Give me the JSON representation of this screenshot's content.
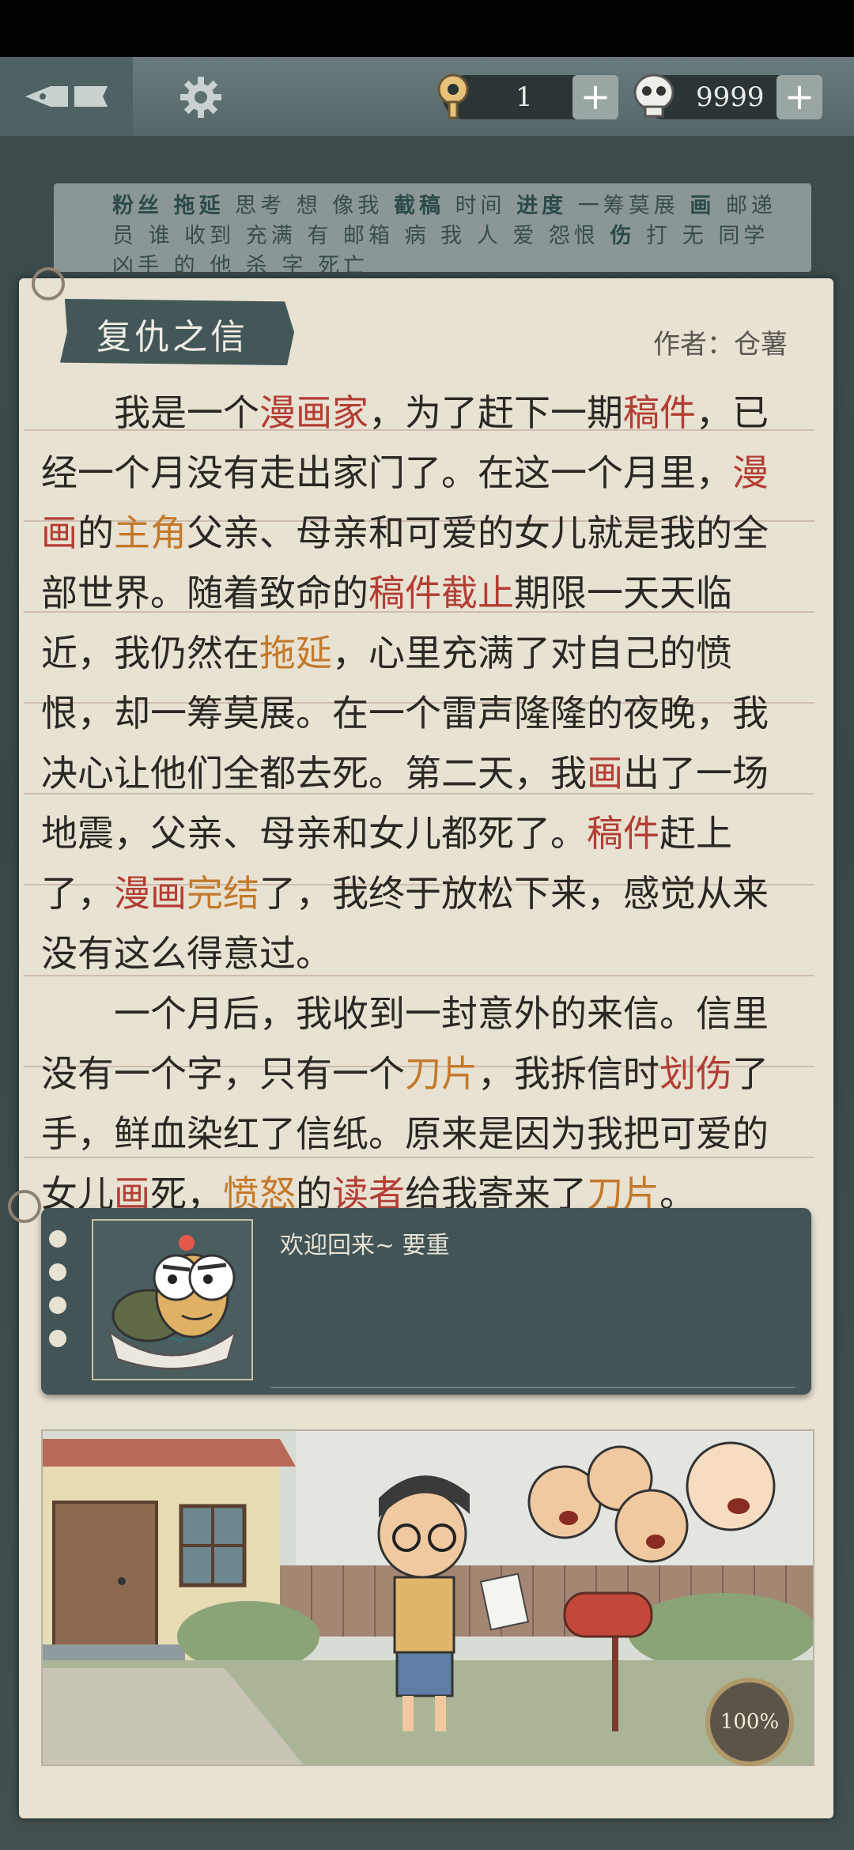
{
  "topbar": {
    "key_count": "1",
    "coin_count": "9999",
    "plus_label": "+"
  },
  "hint_words": [
    "粉丝",
    "拖延",
    "思考",
    "想",
    "像我",
    "截稿",
    "时间",
    "进度",
    "一筹莫展",
    "画",
    "邮递员",
    "谁",
    "收到",
    "充满",
    "有",
    "邮箱",
    "病",
    "我",
    "人",
    "爱",
    "怨恨",
    "伤",
    "打",
    "无",
    "同学",
    "凶手",
    "的",
    "他",
    "杀",
    "字",
    "死亡"
  ],
  "story": {
    "title": "复仇之信",
    "author": "作者：仓薯",
    "paragraph1": [
      {
        "t": "我是一个"
      },
      {
        "t": "漫画家",
        "c": "r"
      },
      {
        "t": "，为了赶下一期"
      },
      {
        "t": "稿件",
        "c": "r"
      },
      {
        "t": "，已经一个月没有走出家门了。在这一个月里，"
      },
      {
        "t": "漫画",
        "c": "r"
      },
      {
        "t": "的"
      },
      {
        "t": "主角",
        "c": "o"
      },
      {
        "t": "父亲、母亲和可爱的女儿就是我的全部世界。随着致命的"
      },
      {
        "t": "稿件截止",
        "c": "r"
      },
      {
        "t": "期限一天天临近，我仍然在"
      },
      {
        "t": "拖延",
        "c": "o"
      },
      {
        "t": "，心里充满了对自己的愤恨，却一筹莫展。在一个雷声隆隆的夜晚，我决心让他们全都去死。第二天，我"
      },
      {
        "t": "画",
        "c": "r"
      },
      {
        "t": "出了一场地震，父亲、母亲和女儿都死了。"
      },
      {
        "t": "稿件",
        "c": "r"
      },
      {
        "t": "赶上了，"
      },
      {
        "t": "漫画",
        "c": "r"
      },
      {
        "t": "完结",
        "c": "o"
      },
      {
        "t": "了，我终于放松下来，感觉从来没有这么得意过。"
      }
    ],
    "paragraph2": [
      {
        "t": "一个月后，我收到一封意外的来信。信里没有一个字，只有一个"
      },
      {
        "t": "刀片",
        "c": "o"
      },
      {
        "t": "，我拆信时"
      },
      {
        "t": "划伤",
        "c": "r"
      },
      {
        "t": "了手，鲜血染红了信纸。原来是因为我把可爱的女儿"
      },
      {
        "t": "画",
        "c": "r"
      },
      {
        "t": "死，"
      },
      {
        "t": "愤怒",
        "c": "o"
      },
      {
        "t": "的"
      },
      {
        "t": "读者",
        "c": "r"
      },
      {
        "t": "给我寄来了"
      },
      {
        "t": "刀片",
        "c": "o"
      },
      {
        "t": "。"
      }
    ]
  },
  "dialog": {
    "text": "欢迎回来~ 要重"
  },
  "scene": {
    "progress": "100%"
  },
  "colors": {
    "highlight_red": "#b33e34",
    "highlight_orange": "#c47a2c",
    "panel": "#425456"
  }
}
